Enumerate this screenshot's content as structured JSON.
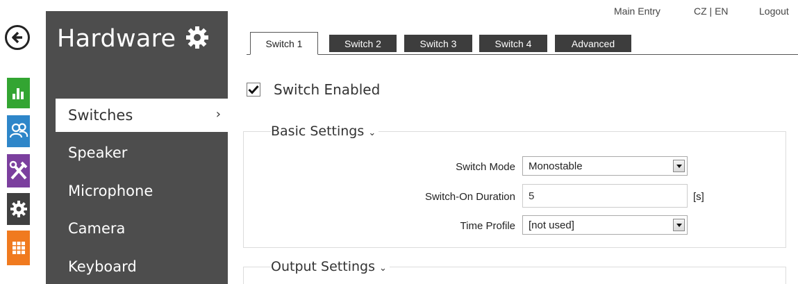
{
  "header": {
    "links": [
      "Main Entry",
      "CZ | EN",
      "Logout"
    ]
  },
  "rail": {
    "icons": [
      "back-arrow-icon",
      "status-chart-icon",
      "users-icon",
      "tools-icon",
      "gear-icon",
      "services-grid-icon"
    ],
    "colors": {
      "status": "#33a532",
      "users": "#2e86c9",
      "hardware": "#7b3f9e",
      "settings": "#404040",
      "services": "#f07a1f"
    }
  },
  "sidebar": {
    "title": "Hardware",
    "items": [
      {
        "label": "Switches",
        "active": true
      },
      {
        "label": "Speaker"
      },
      {
        "label": "Microphone"
      },
      {
        "label": "Camera"
      },
      {
        "label": "Keyboard"
      }
    ],
    "active_chevron": "›"
  },
  "tabs": [
    {
      "label": "Switch 1",
      "active": true
    },
    {
      "label": "Switch 2"
    },
    {
      "label": "Switch 3"
    },
    {
      "label": "Switch 4"
    },
    {
      "label": "Advanced"
    }
  ],
  "switch_enabled": {
    "label": "Switch Enabled",
    "checked": true
  },
  "basic_settings": {
    "title": "Basic Settings",
    "switch_mode": {
      "label": "Switch Mode",
      "value": "Monostable"
    },
    "switch_on_duration": {
      "label": "Switch-On Duration",
      "value": "5",
      "unit": "[s]"
    },
    "time_profile": {
      "label": "Time Profile",
      "value": "[not used]"
    }
  },
  "output_settings": {
    "title": "Output Settings"
  }
}
